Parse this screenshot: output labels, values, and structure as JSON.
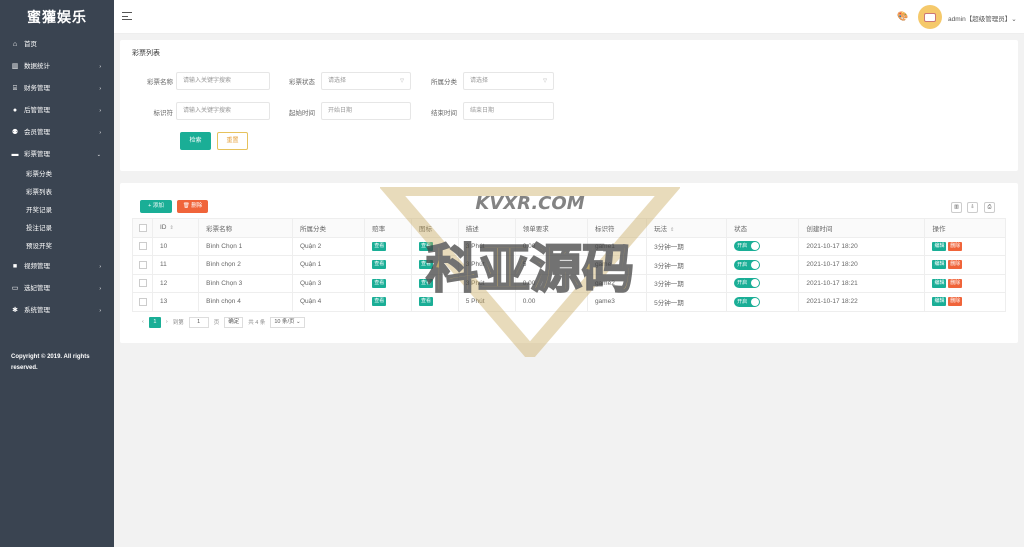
{
  "brand": "蜜獾娱乐",
  "sidebar": {
    "items": [
      {
        "icon": "home-icon",
        "glyph": "⌂",
        "label": "首页",
        "arrow": ""
      },
      {
        "icon": "bar-chart-icon",
        "glyph": "▥",
        "label": "数据统计",
        "arrow": "›"
      },
      {
        "icon": "bank-icon",
        "glyph": "⌸",
        "label": "财务管理",
        "arrow": "›"
      },
      {
        "icon": "user-icon",
        "glyph": "●",
        "label": "后管管理",
        "arrow": "›"
      },
      {
        "icon": "users-icon",
        "glyph": "⚉",
        "label": "会员管理",
        "arrow": "›"
      },
      {
        "icon": "gamepad-icon",
        "glyph": "▬",
        "label": "彩票管理",
        "arrow": "⌄"
      }
    ],
    "sub_items": [
      "彩票分类",
      "彩票列表",
      "开奖记录",
      "投注记录",
      "预设开奖"
    ],
    "items_after": [
      {
        "icon": "video-icon",
        "glyph": "■",
        "label": "视频管理",
        "arrow": "›"
      },
      {
        "icon": "card-icon",
        "glyph": "▭",
        "label": "选妃管理",
        "arrow": "›"
      },
      {
        "icon": "gear-icon",
        "glyph": "✱",
        "label": "系统管理",
        "arrow": "›"
      }
    ],
    "copyright": "Copyright © 2019. All rights reserved."
  },
  "header": {
    "user": "admin【超级管理员】⌄"
  },
  "filter": {
    "title": "彩票列表",
    "name_label": "彩票名称",
    "name_placeholder": "请输入关键字搜索",
    "status_label": "彩票状态",
    "status_value": "请选择",
    "category_label": "所属分类",
    "category_value": "请选择",
    "key_label": "标识符",
    "key_placeholder": "请输入关键字搜索",
    "start_label": "起始时间",
    "start_placeholder": "开始日期",
    "end_label": "结束时间",
    "end_placeholder": "结束日期",
    "search_btn": "检索",
    "reset_btn": "重置"
  },
  "table": {
    "add_btn": "+ 添加",
    "del_btn": "🗑 删除",
    "headers": [
      "ID",
      "彩票名称",
      "所属分类",
      "赔率",
      "图标",
      "描述",
      "领单要求",
      "标识符",
      "玩法",
      "状态",
      "创建时间",
      "操作"
    ],
    "view_label": "查看",
    "switch_label": "开启",
    "edit_label": "编辑",
    "delete_label": "删除",
    "rows": [
      {
        "id": "10",
        "name": "Bình Chọn 1",
        "cat": "Quận 2",
        "desc": "3 Phút",
        "req": "0.00",
        "key": "game1",
        "play": "3分钟一期",
        "time": "2021-10-17 18:20"
      },
      {
        "id": "11",
        "name": "Bình chọn 2",
        "cat": "Quận 1",
        "desc": "3 Phút",
        "req": "5",
        "key": "game",
        "play": "3分钟一期",
        "time": "2021-10-17 18:20"
      },
      {
        "id": "12",
        "name": "Bình Chọn 3",
        "cat": "Quận 3",
        "desc": "3 Phút",
        "req": "0.00",
        "key": "game2",
        "play": "3分钟一期",
        "time": "2021-10-17 18:21"
      },
      {
        "id": "13",
        "name": "Bình chọn 4",
        "cat": "Quận 4",
        "desc": "5 Phút",
        "req": "0.00",
        "key": "game3",
        "play": "5分钟一期",
        "time": "2021-10-17 18:22"
      }
    ]
  },
  "pagination": {
    "current": "1",
    "goto_label": "到第",
    "page_input": "1",
    "page_unit": "页",
    "confirm": "确定",
    "total": "共 4 条",
    "per_page": "10 条/页 ⌄"
  },
  "watermark": {
    "line1": "KVXR.COM",
    "line2": "科亚源码"
  }
}
